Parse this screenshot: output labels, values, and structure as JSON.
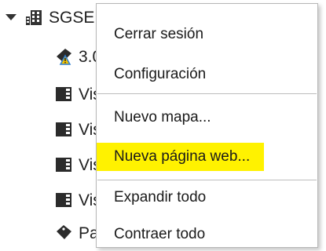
{
  "tree": {
    "root": {
      "label": "SGSE",
      "icon": "building-icon",
      "expanded": true
    },
    "children": [
      {
        "label": "3.0",
        "icon": "warning-map-icon"
      },
      {
        "label": "Vis",
        "icon": "grid-view-icon"
      },
      {
        "label": "Vis",
        "icon": "grid-view-icon"
      },
      {
        "label": "Vis",
        "icon": "grid-view-icon"
      },
      {
        "label": "Vis",
        "icon": "grid-view-icon"
      },
      {
        "label": "Pa",
        "icon": "tag-icon"
      }
    ]
  },
  "context_menu": {
    "items": [
      {
        "label": "Cerrar sesión"
      },
      {
        "label": "Configuración"
      },
      {
        "label": "Nuevo mapa..."
      },
      {
        "label": "Nueva página web...",
        "highlighted": true,
        "highlight_color": "#fff200"
      },
      {
        "label": "Expandir todo"
      },
      {
        "label": "Contraer todo"
      }
    ]
  },
  "colors": {
    "text": "#1a1a1a",
    "highlight": "#fff200",
    "menu_border": "#b7b7b7",
    "separator": "#bdbdbd",
    "icon_dark": "#2b2b2b",
    "warning_blue": "#2f7fd0",
    "warning_yellow": "#f2c200"
  }
}
